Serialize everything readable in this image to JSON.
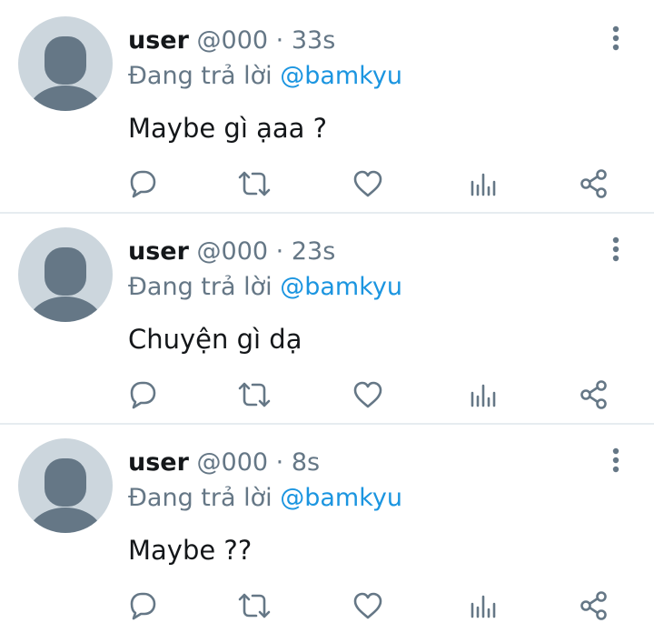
{
  "colors": {
    "accent": "#1b95e0",
    "muted": "#657786",
    "text": "#14171a",
    "avatar_bg": "#ccd6dd",
    "avatar_fg": "#657786",
    "divider": "#e6ecf0"
  },
  "icons": {
    "more": "more-vertical-icon",
    "reply": "reply-icon",
    "retweet": "retweet-icon",
    "like": "heart-icon",
    "stats": "stats-icon",
    "share": "share-icon"
  },
  "tweets": [
    {
      "name": "user",
      "handle": "@000",
      "separator": "·",
      "time": "33s",
      "replying_prefix": "Đang trả lời",
      "replying_to": "@bamkyu",
      "text": "Maybe gì ạaa ?"
    },
    {
      "name": "user",
      "handle": "@000",
      "separator": "·",
      "time": "23s",
      "replying_prefix": "Đang trả lời",
      "replying_to": "@bamkyu",
      "text": "Chuyện gì dạ"
    },
    {
      "name": "user",
      "handle": "@000",
      "separator": "·",
      "time": "8s",
      "replying_prefix": "Đang trả lời",
      "replying_to": "@bamkyu",
      "text": "Maybe ??"
    }
  ]
}
